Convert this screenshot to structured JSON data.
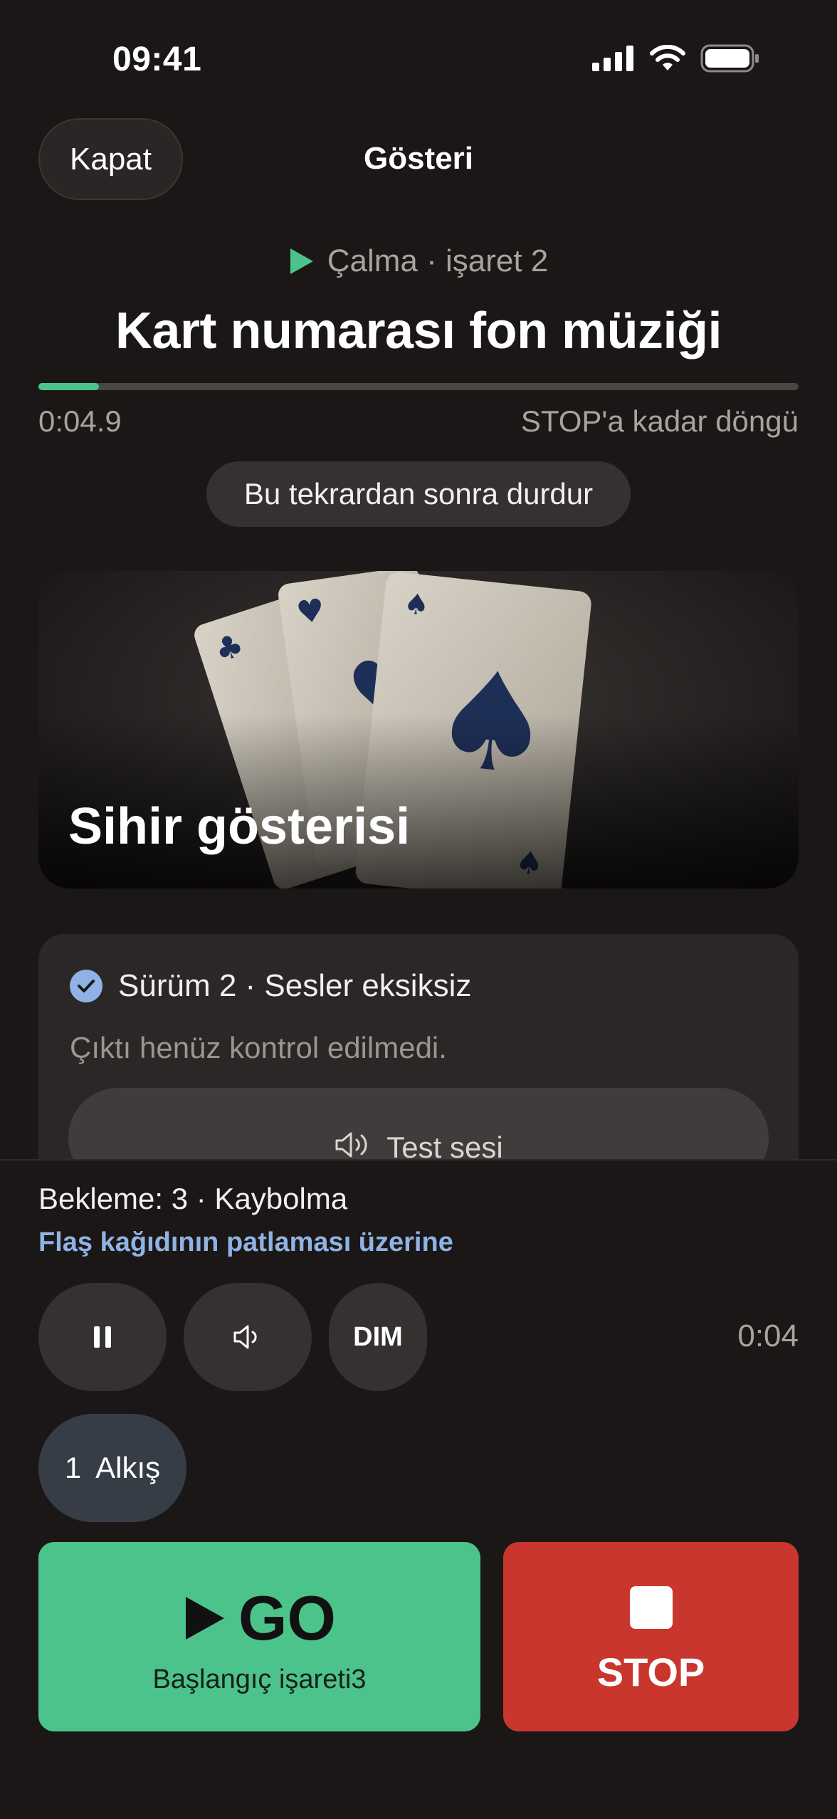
{
  "status_bar": {
    "time": "09:41"
  },
  "nav": {
    "close_label": "Kapat",
    "title": "Gösteri"
  },
  "playback": {
    "status": "Çalma · işaret 2",
    "cue_title": "Kart numarası fon müziği",
    "progress_fraction": 0.08,
    "elapsed": "0:04.9",
    "loop_text": "STOP'a kadar döngü",
    "stop_after_label": "Bu tekrardan sonra durdur"
  },
  "hero": {
    "title": "Sihir gösterisi"
  },
  "info_card": {
    "version_text": "Sürüm 2 · Sesler eksiksiz",
    "output_note": "Çıktı henüz kontrol edilmedi.",
    "test_label": "Test sesi"
  },
  "bottom": {
    "waiting": "Bekleme: 3 · Kaybolma",
    "trigger": "Flaş kağıdının patlaması üzerine",
    "dim_label": "DIM",
    "remaining": "0:04",
    "applause_count": "1",
    "applause_label": "Alkış",
    "go_label": "GO",
    "go_sub": "Başlangıç işareti3",
    "stop_label": "STOP"
  },
  "colors": {
    "accent_green": "#4cc38a",
    "stop_red": "#c9362e",
    "link_blue": "#8fb3e4"
  },
  "icons": [
    "signal-icon",
    "wifi-icon",
    "battery-icon",
    "play-icon",
    "check-icon",
    "speaker-icon",
    "pause-icon"
  ]
}
